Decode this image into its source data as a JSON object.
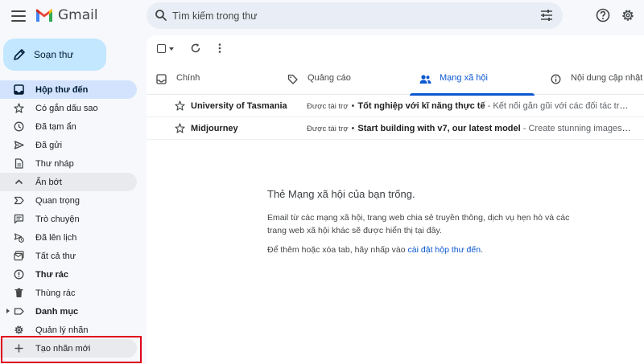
{
  "header": {
    "app_name": "Gmail",
    "search_placeholder": "Tìm kiếm trong thư",
    "icons": [
      "menu-icon",
      "gmail-logo",
      "search-icon",
      "filter-icon",
      "help-icon",
      "settings-icon"
    ]
  },
  "compose": {
    "label": "Soạn thư"
  },
  "sidebar": {
    "items": [
      {
        "label": "Hộp thư đến",
        "icon": "inbox-icon"
      },
      {
        "label": "Có gắn dấu sao",
        "icon": "star-icon"
      },
      {
        "label": "Đã tạm ẩn",
        "icon": "clock-icon"
      },
      {
        "label": "Đã gửi",
        "icon": "send-icon"
      },
      {
        "label": "Thư nháp",
        "icon": "draft-icon"
      },
      {
        "label": "Ẩn bớt",
        "icon": "chevron-up-icon"
      },
      {
        "label": "Quan trọng",
        "icon": "important-icon"
      },
      {
        "label": "Trò chuyện",
        "icon": "chat-icon"
      },
      {
        "label": "Đã lên lịch",
        "icon": "scheduled-icon"
      },
      {
        "label": "Tất cả thư",
        "icon": "all-mail-icon"
      },
      {
        "label": "Thư rác",
        "icon": "spam-icon"
      },
      {
        "label": "Thùng rác",
        "icon": "trash-icon"
      },
      {
        "label": "Danh mục",
        "icon": "label-icon"
      },
      {
        "label": "Quản lý nhãn",
        "icon": "gear-icon"
      },
      {
        "label": "Tạo nhãn mới",
        "icon": "plus-icon"
      }
    ]
  },
  "tabs": [
    {
      "label": "Chính",
      "icon": "inbox-icon"
    },
    {
      "label": "Quảng cáo",
      "icon": "tag-icon"
    },
    {
      "label": "Mạng xã hội",
      "icon": "people-icon"
    },
    {
      "label": "Nội dung cập nhật",
      "icon": "info-icon"
    }
  ],
  "emails": [
    {
      "sender": "University of Tasmania",
      "sponsored": "Được tài trợ",
      "subject": "Tốt nghiệp với kĩ năng thực tế",
      "snippet": " - Kết nối gắn gũi với các đối tác trong ng..."
    },
    {
      "sender": "Midjourney",
      "sponsored": "Được tài trợ",
      "subject": "Start building with v7, our latest model",
      "snippet": " - Create stunning images in se..."
    }
  ],
  "empty_state": {
    "title": "Thẻ Mạng xã hội của bạn trống.",
    "description": "Email từ các mạng xã hội, trang web chia sẻ truyền thông, dịch vụ hẹn hò và các trang web xã hội khác sẽ được hiển thị tại đây.",
    "hint_prefix": "Để thêm hoặc xóa tab, hãy nhấp vào ",
    "hint_link": "cài đặt hộp thư đến",
    "hint_suffix": "."
  },
  "colors": {
    "accent": "#0b57d0",
    "compose_bg": "#c2e7ff",
    "active_nav": "#d3e3fd",
    "highlight_box": "#e0001b"
  }
}
